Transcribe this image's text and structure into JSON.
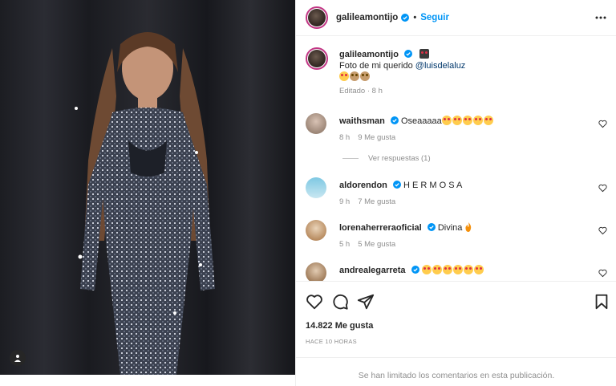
{
  "post": {
    "author": "galileamontijo",
    "follow_label": "Seguir",
    "dot": "•"
  },
  "caption": {
    "username": "galileamontijo",
    "text_prefix": "Foto de mi querido ",
    "mention": "@luisdelaluz",
    "meta": "Editado · 8 h"
  },
  "comments": [
    {
      "username": "waithsman",
      "text": "Oseaaaaa",
      "emoji_count": 5,
      "time": "8 h",
      "likes": "9 Me gusta"
    },
    {
      "username": "aldorendon",
      "text": "H E R M O S A",
      "emoji_count": 0,
      "time": "9 h",
      "likes": "7 Me gusta"
    },
    {
      "username": "lorenaherreraoficial",
      "text": "Divina",
      "emoji_count": 0,
      "time": "5 h",
      "likes": "5 Me gusta"
    },
    {
      "username": "andrealegarreta",
      "text": "",
      "emoji_count": 6,
      "time": "",
      "likes": ""
    }
  ],
  "replies_label": "Ver respuestas (1)",
  "likes_count": "14.822 Me gusta",
  "time_ago": "HACE 10 HORAS",
  "comments_limited": "Se han limitado los comentarios en esta publicación.",
  "colors": {
    "link": "#0095f6",
    "verified": "#0095f6",
    "muted": "#8e8e8e"
  },
  "icons": [
    "heart-icon",
    "comment-icon",
    "share-icon",
    "bookmark-icon",
    "more-icon",
    "verified-icon",
    "tagged-user-icon"
  ]
}
